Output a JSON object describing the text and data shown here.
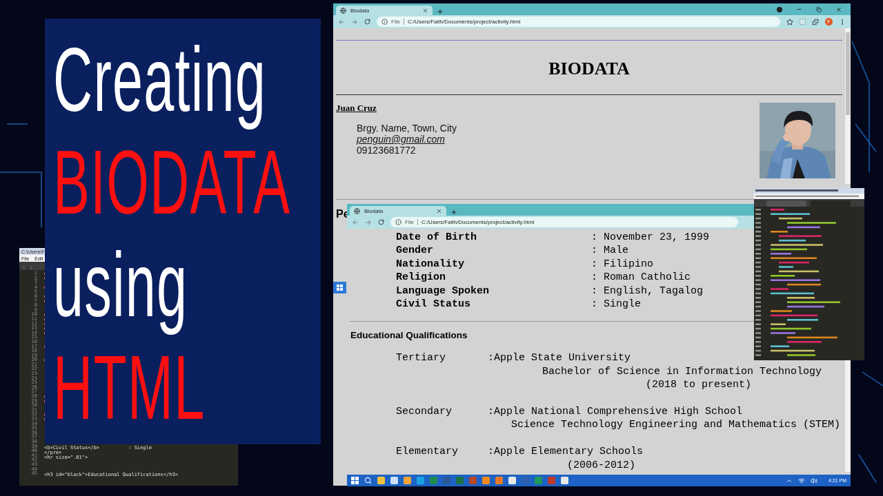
{
  "title_lines": [
    {
      "text": "Creating",
      "color": "#ffffff"
    },
    {
      "text": "BIODATA",
      "color": "#ff1010"
    },
    {
      "text": "using",
      "color": "#ffffff"
    },
    {
      "text": "HTML",
      "color": "#ff1010"
    }
  ],
  "left_editor": {
    "title": "C:\\Users\\F",
    "menu": [
      "File",
      "Edit"
    ],
    "line_numbers": [
      "1",
      "2",
      "3",
      "4",
      "5",
      "6",
      "7",
      "8",
      "9",
      "10",
      "11",
      "12",
      "13",
      "14",
      "15",
      "16",
      "17",
      "18",
      "19",
      "20",
      "21",
      "22",
      "23",
      "24",
      "25",
      "26",
      "27",
      "28",
      "29",
      "30",
      "31",
      "32",
      "33",
      "34",
      "35",
      "36",
      "37",
      "38",
      "39",
      "40",
      "41",
      "42",
      "43",
      "44",
      "45"
    ],
    "code_lines": [
      {
        "code": "<b>Civil Status</b>          : Single"
      },
      {
        "code": "</pre>"
      },
      {
        "code": "<hr size=\".01\">"
      },
      {
        "code": "<h3 id=\"black\">Educational Qualifications</h3>"
      }
    ]
  },
  "main_browser": {
    "tab": {
      "title": "Biodata",
      "selected": true
    },
    "address": {
      "scheme": "File",
      "url": "C:/Users/Faith/Documents/project/activity.html"
    },
    "avatar": "F",
    "page": {
      "heading": "BIODATA",
      "name": "Juan Cruz",
      "address_lines": [
        {
          "kind": "plain",
          "text": "Brgy. Name, Town, City"
        },
        {
          "kind": "email",
          "text": "penguin@gmail.com"
        },
        {
          "kind": "plain",
          "text": "09123681772"
        }
      ],
      "section_heading": "Pe"
    }
  },
  "second_browser": {
    "tab": {
      "title": "Biodata",
      "selected": true
    },
    "address": {
      "scheme": "File",
      "url": "C:/Users/Faith/Documents/project/activity.html"
    },
    "personal": [
      {
        "label": "Date of Birth",
        "value": ": November 23, 1999"
      },
      {
        "label": "Gender",
        "value": ": Male"
      },
      {
        "label": "Nationality",
        "value": ": Filipino"
      },
      {
        "label": "Religion",
        "value": ": Roman Catholic"
      },
      {
        "label": "Language Spoken",
        "value": ": English, Tagalog"
      },
      {
        "label": "Civil Status",
        "value": ": Single"
      }
    ],
    "education_heading": "Educational Qualifications",
    "education": [
      {
        "level": "Tertiary",
        "lines": [
          ":Apple State University",
          "Bachelor of Science in Information Technology",
          "(2018 to present)"
        ]
      },
      {
        "level": "Secondary",
        "lines": [
          ":Apple National Comprehensive High School",
          "Science Technology Engineering and Mathematics (STEM)"
        ]
      },
      {
        "level": "Elementary",
        "lines": [
          ":Apple Elementary Schools",
          "(2006-2012)"
        ]
      }
    ],
    "taskbar": {
      "clock": "4:21 PM"
    }
  }
}
